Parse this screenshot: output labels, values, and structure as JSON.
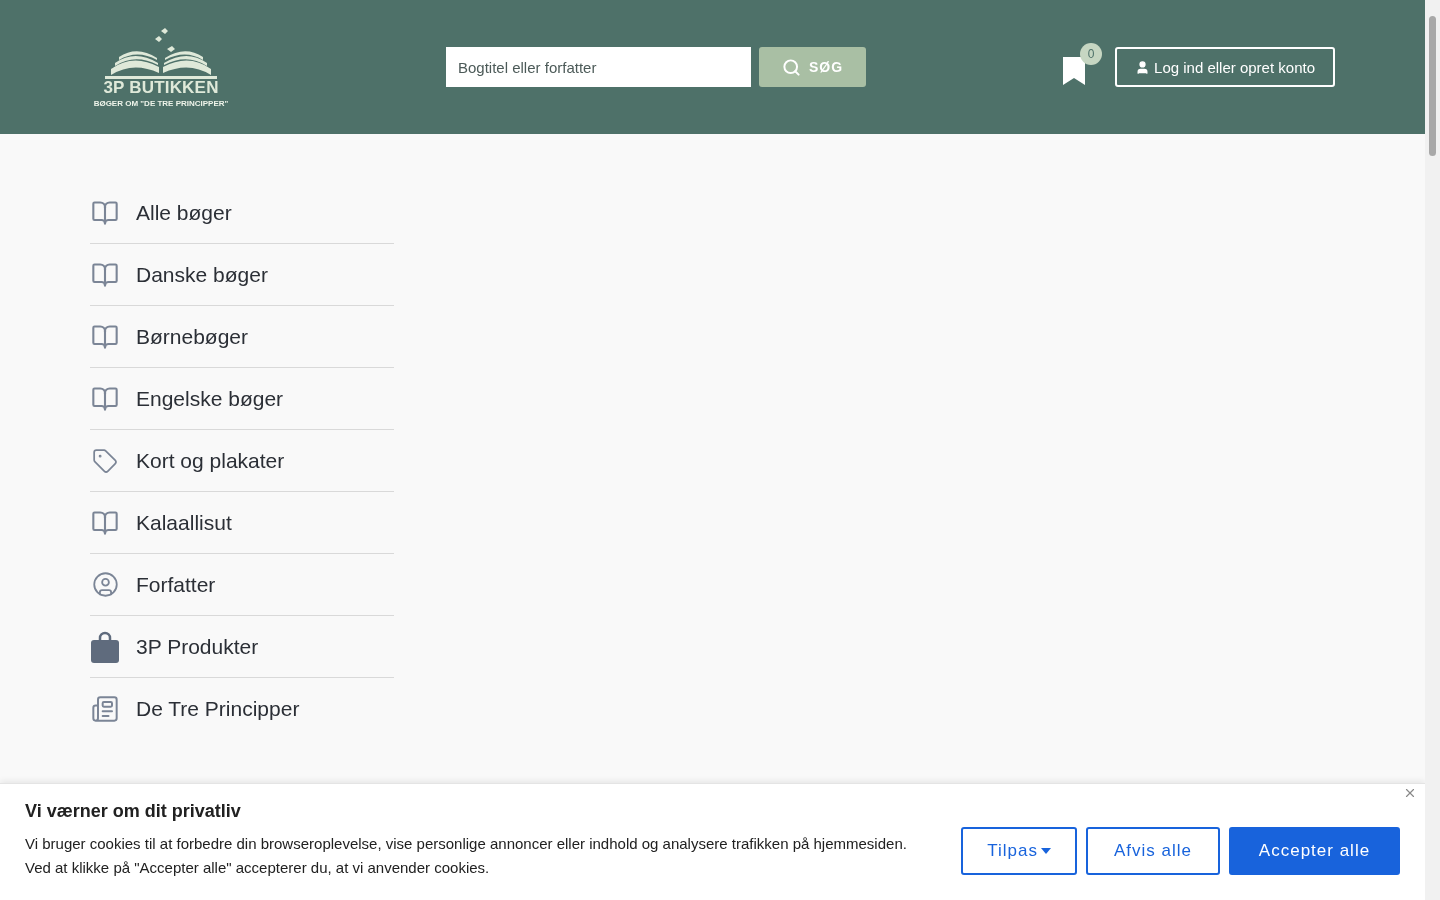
{
  "header": {
    "logo": {
      "title": "3P BUTIKKEN",
      "subtitle": "BØGER OM \"DE TRE PRINCIPPER\""
    },
    "search": {
      "placeholder": "Bogtitel eller forfatter",
      "button": "SØG"
    },
    "bookmarks": {
      "count": "0"
    },
    "login": "Log ind eller opret konto"
  },
  "categories": [
    {
      "label": "Alle bøger",
      "kind": "book"
    },
    {
      "label": "Danske bøger",
      "kind": "book"
    },
    {
      "label": "Børnebøger",
      "kind": "book"
    },
    {
      "label": "Engelske bøger",
      "kind": "book"
    },
    {
      "label": "Kort og plakater",
      "kind": "tag"
    },
    {
      "label": "Kalaallisut",
      "kind": "book"
    },
    {
      "label": "Forfatter",
      "kind": "person"
    },
    {
      "label": "3P Produkter",
      "kind": "bag"
    },
    {
      "label": "De Tre Principper",
      "kind": "news"
    }
  ],
  "cookie_banner": {
    "title": "Vi værner om dit privatliv",
    "text": [
      "Vi bruger cookies til at forbedre din browseroplevelse, vise personlige annoncer eller indhold og analysere trafikken på hjemmesiden.",
      "Ved at klikke på \"Accepter alle\" accepterer du, at vi anvender cookies."
    ],
    "buttons": [
      {
        "label": "Tilpas",
        "kind": "dropdown"
      },
      {
        "label": "Afvis alle",
        "kind": "outline"
      },
      {
        "label": "Accepter alle",
        "kind": "primary"
      }
    ]
  }
}
